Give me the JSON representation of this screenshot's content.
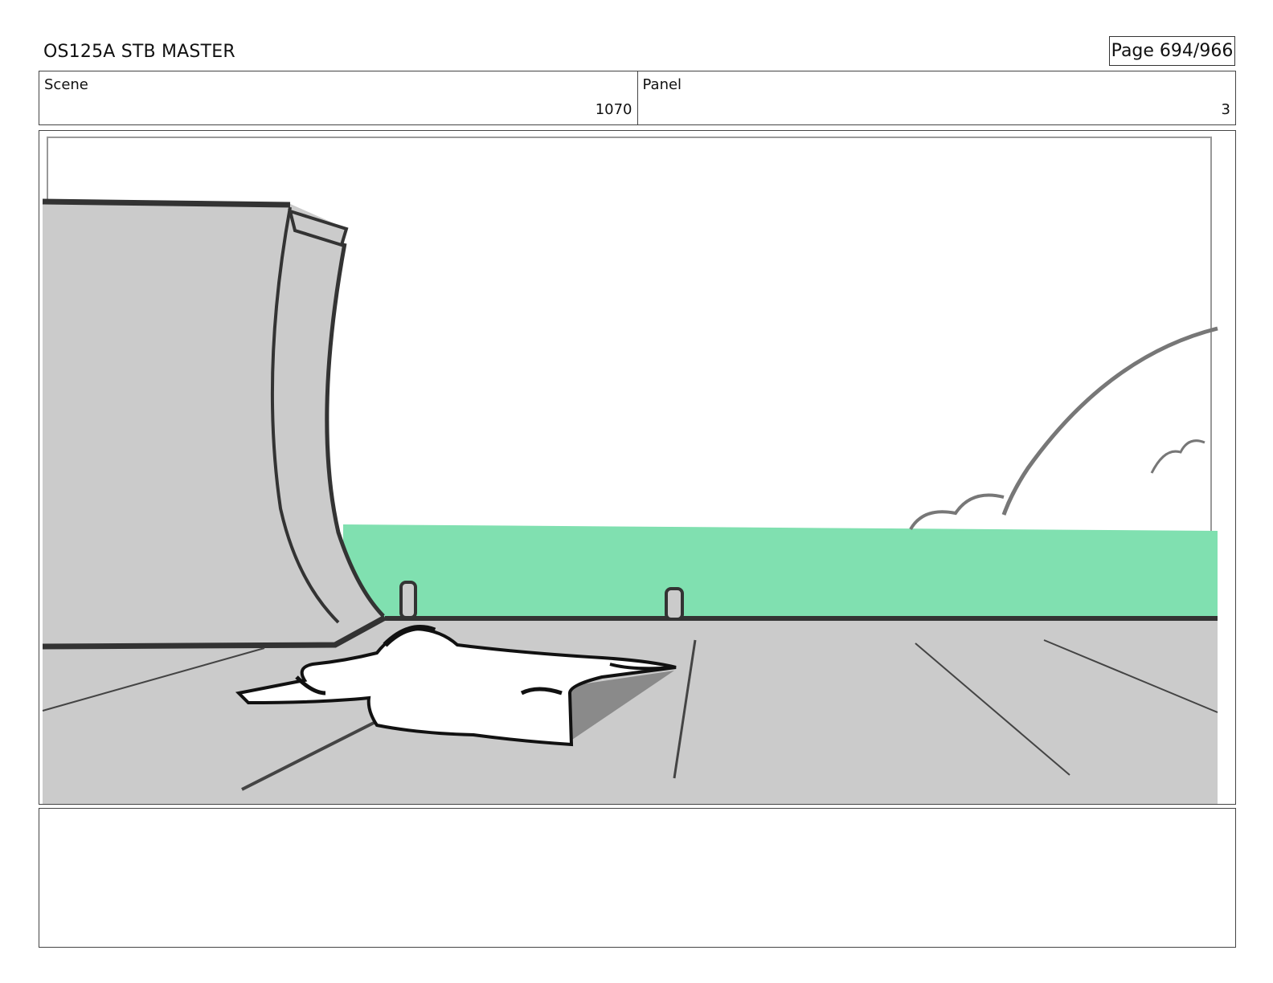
{
  "header": {
    "title": "OS125A STB MASTER",
    "page": "Page 694/966"
  },
  "scene": {
    "label": "Scene",
    "value": "1070"
  },
  "panel": {
    "label": "Panel",
    "value": "3"
  },
  "notes": {
    "text": ""
  },
  "colors": {
    "grass": "#80e0b0",
    "ramp_gray": "#cbcbcb",
    "ground_gray": "#cbcbcb",
    "shadow_gray": "#8a8a8a",
    "line": "#333333"
  }
}
